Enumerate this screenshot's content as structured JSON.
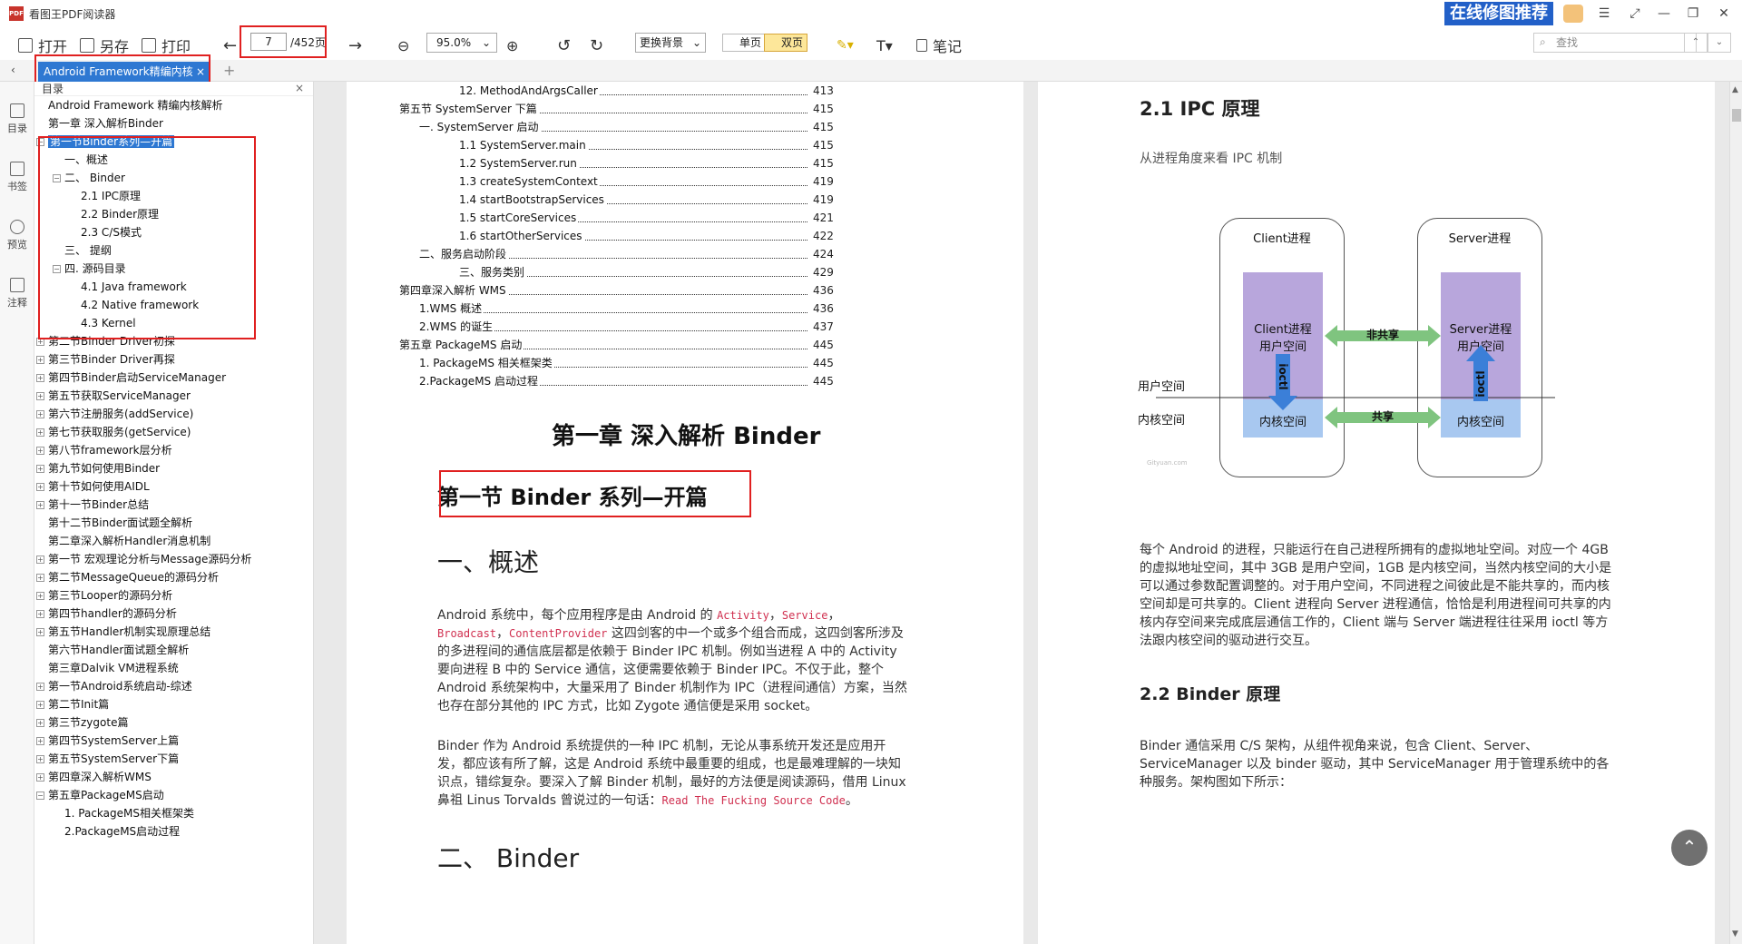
{
  "app": {
    "title": "看图王PDF阅读器",
    "logo_text": "PDF",
    "promo": "在线修图推荐"
  },
  "toolbar": {
    "open": "打开",
    "save_as": "另存",
    "print": "打印",
    "page_current": "7",
    "page_total": "/452页",
    "zoom": "95.0%",
    "background": "更换背景",
    "single": "单页",
    "double": "双页",
    "notes": "笔记",
    "search_placeholder": "查找"
  },
  "tab": {
    "label": "Android Framework精编内核",
    "close": "×"
  },
  "leftnav": {
    "toc": "目录",
    "bookmark": "书签",
    "preview": "预览",
    "annotate": "注释"
  },
  "toc_panel": {
    "header": "目录",
    "items": [
      {
        "label": "Android Framework 精编内核解析",
        "indent": 0,
        "toggle": ""
      },
      {
        "label": "第一章 深入解析Binder",
        "indent": 0,
        "toggle": ""
      },
      {
        "label": "第一节Binder系列—开篇",
        "indent": 0,
        "toggle": "⊟",
        "selected": true
      },
      {
        "label": "一、概述",
        "indent": 1,
        "toggle": ""
      },
      {
        "label": "二、 Binder",
        "indent": 1,
        "toggle": "⊟"
      },
      {
        "label": "2.1 IPC原理",
        "indent": 2,
        "toggle": ""
      },
      {
        "label": "2.2 Binder原理",
        "indent": 2,
        "toggle": ""
      },
      {
        "label": "2.3 C/S模式",
        "indent": 2,
        "toggle": ""
      },
      {
        "label": "三、 提纲",
        "indent": 1,
        "toggle": ""
      },
      {
        "label": "四. 源码目录",
        "indent": 1,
        "toggle": "⊟"
      },
      {
        "label": "4.1 Java framework",
        "indent": 2,
        "toggle": ""
      },
      {
        "label": "4.2 Native framework",
        "indent": 2,
        "toggle": ""
      },
      {
        "label": "4.3 Kernel",
        "indent": 2,
        "toggle": ""
      },
      {
        "label": "第二节Binder Driver初探",
        "indent": 0,
        "toggle": "⊞"
      },
      {
        "label": "第三节Binder Driver再探",
        "indent": 0,
        "toggle": "⊞"
      },
      {
        "label": "第四节Binder启动ServiceManager",
        "indent": 0,
        "toggle": "⊞"
      },
      {
        "label": "第五节获取ServiceManager",
        "indent": 0,
        "toggle": "⊞"
      },
      {
        "label": "第六节注册服务(addService)",
        "indent": 0,
        "toggle": "⊞"
      },
      {
        "label": "第七节获取服务(getService)",
        "indent": 0,
        "toggle": "⊞"
      },
      {
        "label": "第八节framework层分析",
        "indent": 0,
        "toggle": "⊞"
      },
      {
        "label": "第九节如何使用Binder",
        "indent": 0,
        "toggle": "⊞"
      },
      {
        "label": "第十节如何使用AIDL",
        "indent": 0,
        "toggle": "⊞"
      },
      {
        "label": "第十一节Binder总结",
        "indent": 0,
        "toggle": "⊞"
      },
      {
        "label": "第十二节Binder面试题全解析",
        "indent": 0,
        "toggle": ""
      },
      {
        "label": "第二章深入解析Handler消息机制",
        "indent": 0,
        "toggle": ""
      },
      {
        "label": "第一节 宏观理论分析与Message源码分析",
        "indent": 0,
        "toggle": "⊞"
      },
      {
        "label": "第二节MessageQueue的源码分析",
        "indent": 0,
        "toggle": "⊞"
      },
      {
        "label": "第三节Looper的源码分析",
        "indent": 0,
        "toggle": "⊞"
      },
      {
        "label": "第四节handler的源码分析",
        "indent": 0,
        "toggle": "⊞"
      },
      {
        "label": "第五节Handler机制实现原理总结",
        "indent": 0,
        "toggle": "⊞"
      },
      {
        "label": "第六节Handler面试题全解析",
        "indent": 0,
        "toggle": ""
      },
      {
        "label": "第三章Dalvik VM进程系统",
        "indent": 0,
        "toggle": ""
      },
      {
        "label": "第一节Android系统启动-综述",
        "indent": 0,
        "toggle": "⊞"
      },
      {
        "label": "第二节Init篇",
        "indent": 0,
        "toggle": "⊞"
      },
      {
        "label": "第三节zygote篇",
        "indent": 0,
        "toggle": "⊞"
      },
      {
        "label": "第四节SystemServer上篇",
        "indent": 0,
        "toggle": "⊞"
      },
      {
        "label": "第五节SystemServer下篇",
        "indent": 0,
        "toggle": "⊞"
      },
      {
        "label": "第四章深入解析WMS",
        "indent": 0,
        "toggle": "⊞"
      },
      {
        "label": "第五章PackageMS启动",
        "indent": 0,
        "toggle": "⊟"
      },
      {
        "label": "1. PackageMS相关框架类",
        "indent": 1,
        "toggle": ""
      },
      {
        "label": "2.PackageMS启动过程",
        "indent": 1,
        "toggle": ""
      }
    ]
  },
  "left_page": {
    "toc_lines": [
      {
        "text": "12. MethodAndArgsCaller",
        "indent": 3,
        "page": "413"
      },
      {
        "text": "第五节 SystemServer 下篇",
        "indent": 0,
        "page": "415"
      },
      {
        "text": "一. SystemServer 启动",
        "indent": 1,
        "page": "415"
      },
      {
        "text": "1.1 SystemServer.main",
        "indent": 3,
        "page": "415"
      },
      {
        "text": "1.2 SystemServer.run",
        "indent": 3,
        "page": "415"
      },
      {
        "text": "1.3 createSystemContext",
        "indent": 3,
        "page": "419"
      },
      {
        "text": "1.4 startBootstrapServices",
        "indent": 3,
        "page": "419"
      },
      {
        "text": "1.5 startCoreServices",
        "indent": 3,
        "page": "421"
      },
      {
        "text": "1.6 startOtherServices",
        "indent": 3,
        "page": "422"
      },
      {
        "text": "二、服务启动阶段",
        "indent": 1,
        "page": "424"
      },
      {
        "text": "三、服务类别",
        "indent": 3,
        "page": "429"
      },
      {
        "text": "第四章深入解析 WMS",
        "indent": 0,
        "page": "436"
      },
      {
        "text": "1.WMS 概述",
        "indent": 1,
        "page": "436"
      },
      {
        "text": "2.WMS 的诞生",
        "indent": 1,
        "page": "437"
      },
      {
        "text": "第五章 PackageMS 启动",
        "indent": 0,
        "page": "445"
      },
      {
        "text": "1. PackageMS 相关框架类",
        "indent": 1,
        "page": "445"
      },
      {
        "text": "2.PackageMS 启动过程",
        "indent": 1,
        "page": "445"
      }
    ],
    "chapter_title": "第一章  深入解析 Binder",
    "section_title": "第一节 Binder 系列—开篇",
    "h_overview": "一、概述",
    "para1_a": "Android 系统中，每个应用程序是由 Android 的 ",
    "para1_code1": "Activity",
    "para1_sep1": "，",
    "para1_code2": "Service",
    "para1_sep2": "，",
    "para1_code3": "Broadcast",
    "para1_sep3": "，",
    "para1_code4": "ContentProvider",
    "para1_b": " 这四剑客的中一个或多个组合而成，这四剑客所涉及的多进程间的通信底层都是依赖于 Binder IPC 机制。例如当进程 A 中的 Activity 要向进程 B 中的 Service 通信，这便需要依赖于 Binder IPC。不仅于此，整个 Android 系统架构中，大量采用了 Binder 机制作为 IPC（进程间通信）方案，当然也存在部分其他的 IPC 方式，比如 Zygote 通信便是采用 socket。",
    "para2_a": "Binder 作为 Android 系统提供的一种 IPC 机制，无论从事系统开发还是应用开发，都应该有所了解，这是 Android 系统中最重要的组成，也是最难理解的一块知识点，错综复杂。要深入了解 Binder 机制，最好的方法便是阅读源码，借用 Linux 鼻祖 Linus Torvalds 曾说过的一句话：",
    "para2_code": "Read The Fucking Source Code",
    "para2_end": "。",
    "h_binder": "二、  Binder"
  },
  "right_page": {
    "h21": "2.1 IPC 原理",
    "sub21": "从进程角度来看 IPC 机制",
    "diagram": {
      "client_title": "Client进程",
      "server_title": "Server进程",
      "client_user": "Client进程\n用户空间",
      "server_user": "Server进程\n用户空间",
      "client_kernel": "内核空间",
      "server_kernel": "内核空间",
      "not_shared": "非共享",
      "shared": "共享",
      "ioctl": "ioctl",
      "user_space": "用户空间",
      "kernel_space": "内核空间",
      "watermark": "Gityuan.com"
    },
    "para21": "每个 Android 的进程，只能运行在自己进程所拥有的虚拟地址空间。对应一个 4GB 的虚拟地址空间，其中 3GB 是用户空间，1GB 是内核空间，当然内核空间的大小是可以通过参数配置调整的。对于用户空间，不同进程之间彼此是不能共享的，而内核空间却是可共享的。Client 进程向 Server 进程通信，恰恰是利用进程间可共享的内核内存空间来完成底层通信工作的，Client 端与 Server 端进程往往采用 ioctl 等方法跟内核空间的驱动进行交互。",
    "h22": "2.2 Binder 原理",
    "para22": "Binder 通信采用 C/S 架构，从组件视角来说，包含 Client、Server、ServiceManager 以及 binder 驱动，其中 ServiceManager 用于管理系统中的各种服务。架构图如下所示："
  },
  "colors": {
    "accent": "#2e78d2",
    "highlight": "#e02020",
    "purple": "#b8a6dc",
    "blue": "#a8c8f0",
    "green": "#7fc47f"
  }
}
